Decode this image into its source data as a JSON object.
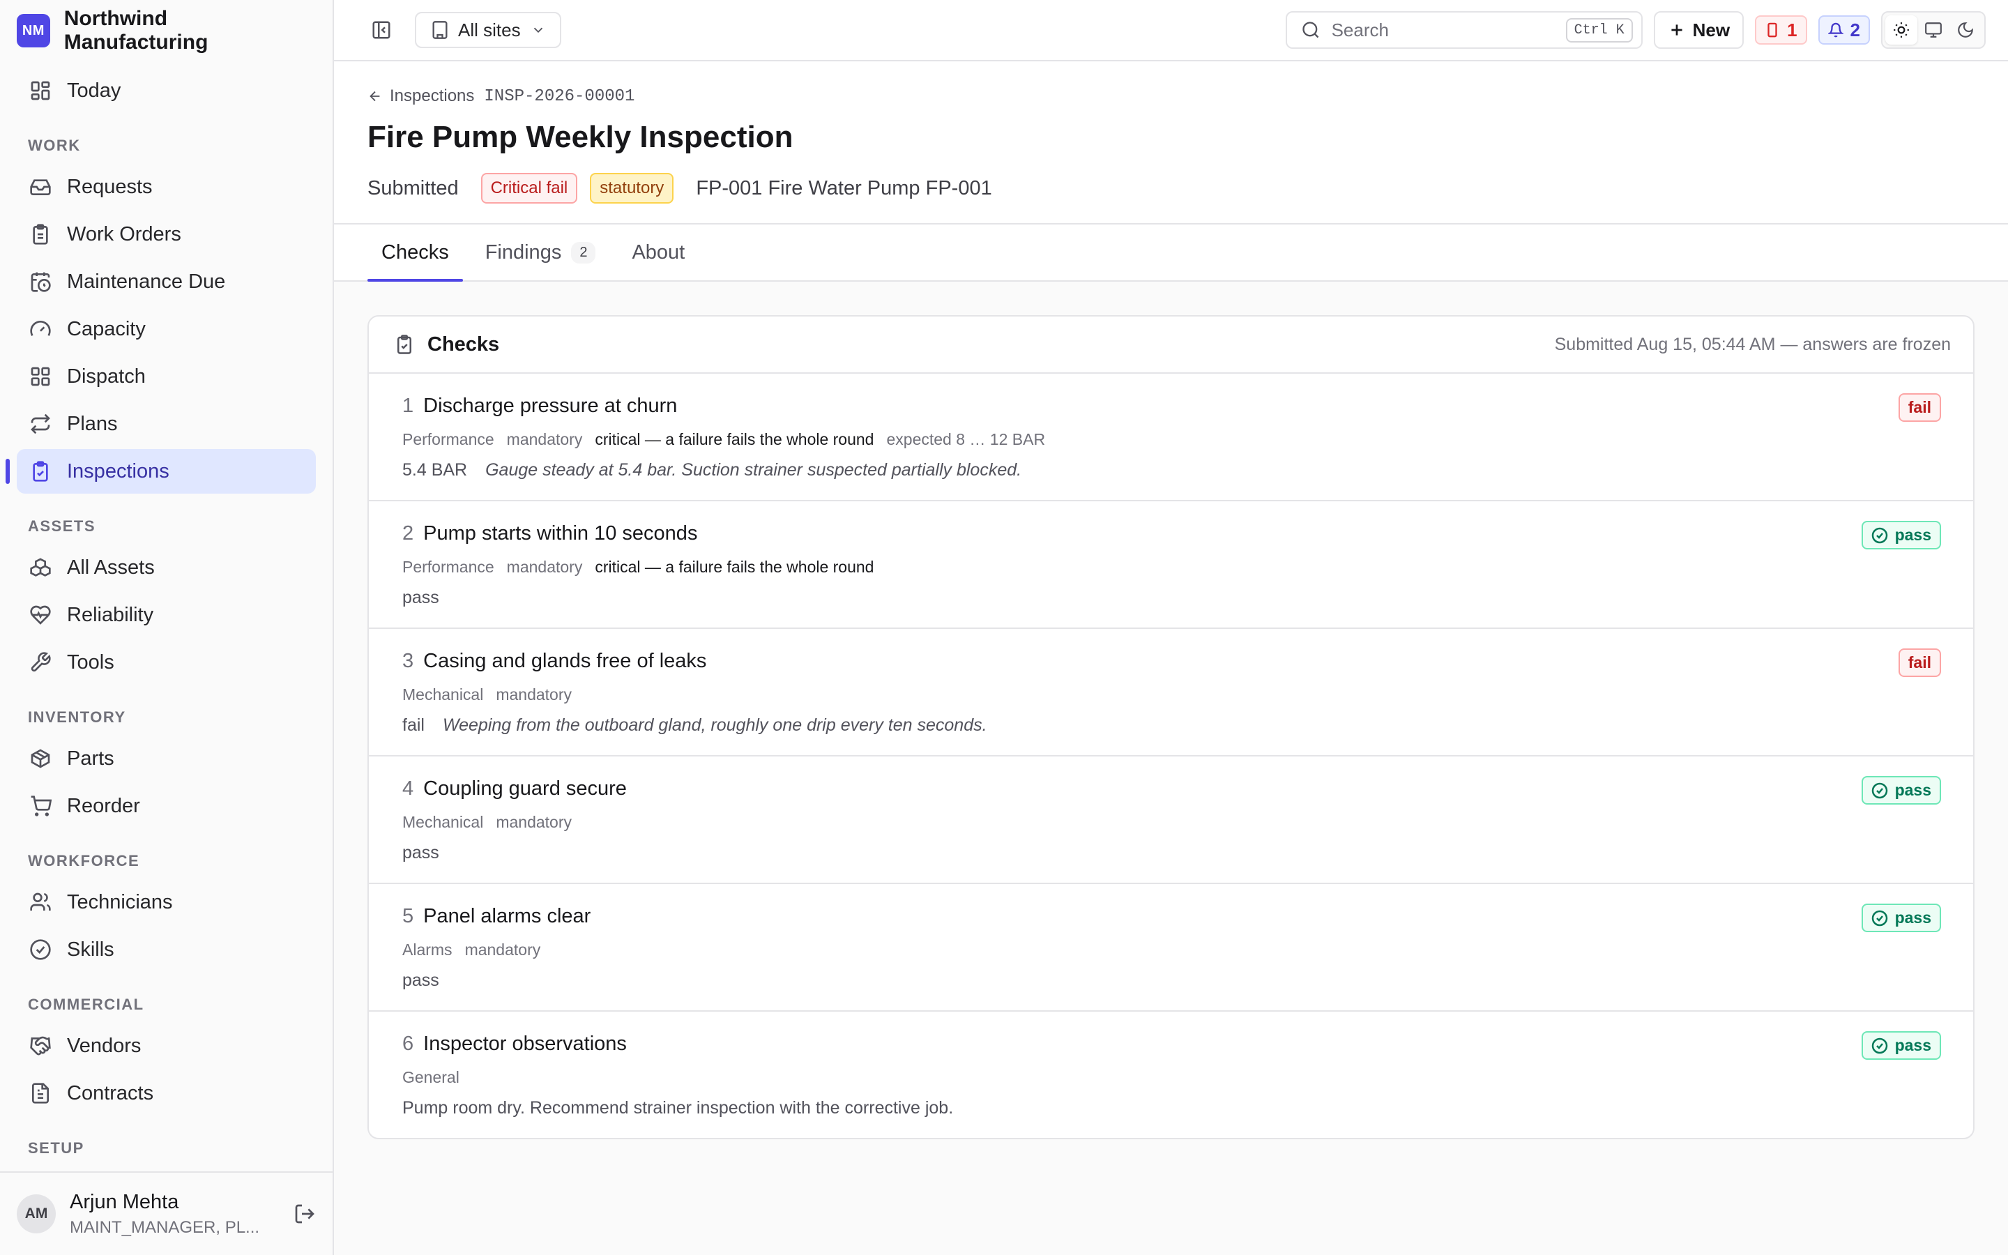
{
  "brand": {
    "logo": "NM",
    "name": "Northwind Manufacturing"
  },
  "sidebar": {
    "today": "Today",
    "sections": {
      "work": "WORK",
      "assets": "ASSETS",
      "inventory": "INVENTORY",
      "workforce": "WORKFORCE",
      "commercial": "COMMERCIAL",
      "setup": "SETUP"
    },
    "items": {
      "requests": "Requests",
      "work_orders": "Work Orders",
      "maintenance_due": "Maintenance Due",
      "capacity": "Capacity",
      "dispatch": "Dispatch",
      "plans": "Plans",
      "inspections": "Inspections",
      "all_assets": "All Assets",
      "reliability": "Reliability",
      "tools": "Tools",
      "parts": "Parts",
      "reorder": "Reorder",
      "technicians": "Technicians",
      "skills": "Skills",
      "vendors": "Vendors",
      "contracts": "Contracts"
    },
    "active": "inspections"
  },
  "user": {
    "initials": "AM",
    "name": "Arjun Mehta",
    "role": "MAINT_MANAGER, PL..."
  },
  "topbar": {
    "site": "All sites",
    "search_placeholder": "Search",
    "search_shortcut": "Ctrl K",
    "new_label": "New",
    "alerts_count": "1",
    "notifications_count": "2"
  },
  "page": {
    "breadcrumb_parent": "Inspections",
    "breadcrumb_code": "INSP-2026-00001",
    "title": "Fire Pump Weekly Inspection",
    "status": "Submitted",
    "badge_critical": "Critical fail",
    "badge_statutory": "statutory",
    "asset": "FP-001 Fire Water Pump FP-001"
  },
  "tabs": [
    {
      "label": "Checks",
      "active": true
    },
    {
      "label": "Findings",
      "count": "2"
    },
    {
      "label": "About"
    }
  ],
  "checks_card": {
    "title": "Checks",
    "note": "Submitted Aug 15, 05:44 AM — answers are frozen",
    "items": [
      {
        "num": "1",
        "title": "Discharge pressure at churn",
        "category": "Performance",
        "mandatory": "mandatory",
        "critical": "critical — a failure fails the whole round",
        "expected": "expected 8 … 12 BAR",
        "answer": "5.4 BAR",
        "note": "Gauge steady at 5.4 bar. Suction strainer suspected partially blocked.",
        "result": "fail"
      },
      {
        "num": "2",
        "title": "Pump starts within 10 seconds",
        "category": "Performance",
        "mandatory": "mandatory",
        "critical": "critical — a failure fails the whole round",
        "answer": "pass",
        "result": "pass"
      },
      {
        "num": "3",
        "title": "Casing and glands free of leaks",
        "category": "Mechanical",
        "mandatory": "mandatory",
        "answer": "fail",
        "note": "Weeping from the outboard gland, roughly one drip every ten seconds.",
        "result": "fail"
      },
      {
        "num": "4",
        "title": "Coupling guard secure",
        "category": "Mechanical",
        "mandatory": "mandatory",
        "answer": "pass",
        "result": "pass"
      },
      {
        "num": "5",
        "title": "Panel alarms clear",
        "category": "Alarms",
        "mandatory": "mandatory",
        "answer": "pass",
        "result": "pass"
      },
      {
        "num": "6",
        "title": "Inspector observations",
        "category": "General",
        "answer": "Pump room dry. Recommend strainer inspection with the corrective job.",
        "result": "pass"
      }
    ]
  },
  "colors": {
    "accent": "#4f46e5",
    "fail": "#b91c1c",
    "pass": "#047857"
  }
}
